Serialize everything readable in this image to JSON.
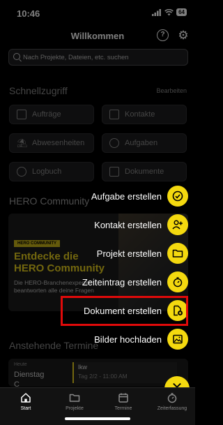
{
  "status": {
    "time": "10:46",
    "battery": "64"
  },
  "header": {
    "title": "Willkommen",
    "help_icon": "help-circle-icon",
    "settings_icon": "gear-icon"
  },
  "search": {
    "placeholder": "Nach Projekte, Dateien, etc. suchen"
  },
  "quick_access": {
    "title": "Schnellzugriff",
    "edit_label": "Bearbeiten",
    "tiles": [
      {
        "label": "Aufträge",
        "icon": "orders-icon"
      },
      {
        "label": "Kontakte",
        "icon": "contact-card-icon"
      },
      {
        "label": "Abwesenheiten",
        "icon": "beach-umbrella-icon"
      },
      {
        "label": "Aufgaben",
        "icon": "check-circle-icon"
      },
      {
        "label": "Logbuch",
        "icon": "compass-icon"
      },
      {
        "label": "Dokumente",
        "icon": "documents-icon"
      }
    ]
  },
  "community": {
    "title": "HERO Community",
    "badge": "HERO COMMUNITY",
    "headline_line1": "Entdecke die",
    "headline_line2": "HERO Community",
    "desc_line1": "Die HERO-Branchenexperten",
    "desc_line2": "beantworten alle deine Fragen"
  },
  "appointments": {
    "title": "Anstehende Termine",
    "today_label": "Heute",
    "day": "Dienstag",
    "day_cont": "C",
    "entry_title": "lkw",
    "entry_time": "Tag 2/2 - 11:00 AM"
  },
  "fab_actions": [
    {
      "label": "Aufgabe erstellen",
      "icon": "check-circle-icon"
    },
    {
      "label": "Kontakt erstellen",
      "icon": "add-person-icon"
    },
    {
      "label": "Projekt erstellen",
      "icon": "folder-icon"
    },
    {
      "label": "Zeiteintrag erstellen",
      "icon": "timer-icon"
    },
    {
      "label": "Dokument erstellen",
      "icon": "add-document-icon"
    },
    {
      "label": "Bilder hochladen",
      "icon": "image-icon"
    }
  ],
  "fab_close_icon": "close-icon",
  "tabs": [
    {
      "label": "Start",
      "icon": "home-icon",
      "active": true
    },
    {
      "label": "Projekte",
      "icon": "folder-icon",
      "active": false
    },
    {
      "label": "Termine",
      "icon": "calendar-icon",
      "active": false
    },
    {
      "label": "Zeiterfassung",
      "icon": "timer-icon",
      "active": false
    }
  ],
  "colors": {
    "accent": "#f4d90f",
    "highlight": "#e00a0a",
    "background": "#000000"
  }
}
